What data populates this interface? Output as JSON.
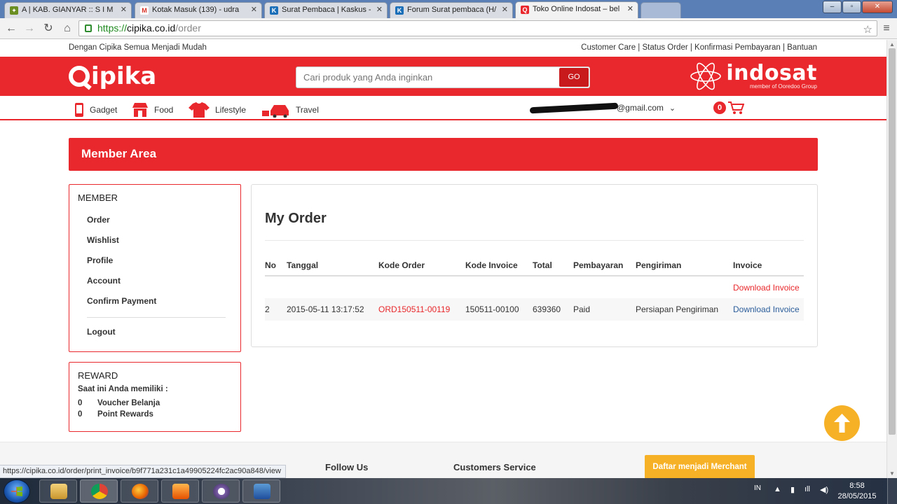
{
  "browser": {
    "tabs": [
      {
        "label": "A | KAB. GIANYAR :: S I M",
        "favicon": "leaf-icon",
        "color": "#6b8e23"
      },
      {
        "label": "Kotak Masuk (139) - udra",
        "favicon": "gmail-icon",
        "color": "#d93025"
      },
      {
        "label": "Surat Pembaca | Kaskus -",
        "favicon": "kaskus-icon",
        "color": "#1a6fb8"
      },
      {
        "label": "Forum Surat pembaca (H/",
        "favicon": "kaskus-icon",
        "color": "#1a6fb8"
      },
      {
        "label": "Toko Online Indosat – bel",
        "favicon": "cipika-icon",
        "color": "#e8282c"
      }
    ],
    "window_buttons": [
      "–",
      "▫",
      "✕"
    ],
    "url_scheme": "https://",
    "url_host": "cipika.co.id",
    "url_path": "/order",
    "status_url": "https://cipika.co.id/order/print_invoice/b9f771a231c1a49905224fc2ac90a848/view"
  },
  "site": {
    "tagline": "Dengan Cipika Semua Menjadi Mudah",
    "top_links": "Customer Care | Status Order | Konfirmasi Pembayaran | Bantuan",
    "logo": "cipika",
    "search_placeholder": "Cari produk yang Anda inginkan",
    "search_button": "GO",
    "partner_logo": "indosat",
    "partner_sub": "member of Ooredoo Group",
    "brand_red": "#e8282c",
    "accent_orange": "#f6b127",
    "categories": [
      {
        "label": "Gadget",
        "icon": "phone-icon"
      },
      {
        "label": "Food",
        "icon": "food-stall-icon"
      },
      {
        "label": "Lifestyle",
        "icon": "shirt-icon"
      },
      {
        "label": "Travel",
        "icon": "car-icon"
      }
    ],
    "user_email_suffix": "@gmail.com",
    "cart_count": "0"
  },
  "member_area": {
    "title": "Member Area",
    "member_heading": "MEMBER",
    "menu": [
      "Order",
      "Wishlist",
      "Profile",
      "Account",
      "Confirm Payment"
    ],
    "logout": "Logout",
    "reward_heading": "REWARD",
    "reward_intro": "Saat ini Anda memiliki :",
    "rewards": [
      {
        "count": "0",
        "label": "Voucher Belanja"
      },
      {
        "count": "0",
        "label": "Point Rewards"
      }
    ]
  },
  "my_order": {
    "title": "My Order",
    "columns": [
      "No",
      "Tanggal",
      "Kode Order",
      "Kode Invoice",
      "Total",
      "Pembayaran",
      "Pengiriman",
      "Invoice"
    ],
    "rows": [
      {
        "no": "",
        "tanggal": "",
        "kode_order": "",
        "kode_invoice": "",
        "total": "",
        "pembayaran": "",
        "pengiriman": "",
        "invoice": "Download Invoice"
      },
      {
        "no": "2",
        "tanggal": "2015-05-11 13:17:52",
        "kode_order": "ORD150511-00119",
        "kode_invoice": "150511-00100",
        "total": "639360",
        "pembayaran": "Paid",
        "pengiriman": "Persiapan Pengiriman",
        "invoice": "Download Invoice"
      }
    ]
  },
  "footer": {
    "headings": [
      "Follow Us",
      "Customers Service"
    ],
    "merchant_button": "Daftar menjadi Merchant"
  },
  "taskbar": {
    "apps": [
      "explorer-icon",
      "chrome-icon",
      "firefox-icon",
      "media-player-icon",
      "cipika-app-icon",
      "word-icon"
    ],
    "language": "IN",
    "time": "8:58",
    "date": "28/05/2015"
  }
}
